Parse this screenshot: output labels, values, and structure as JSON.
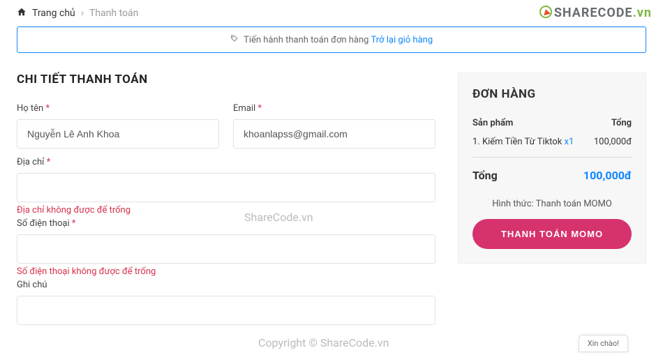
{
  "breadcrumb": {
    "home": "Trang chủ",
    "current": "Thanh toán"
  },
  "logo": {
    "brand": "SHARECODE",
    "tld": ".vn"
  },
  "alert": {
    "text": "Tiến hành thanh toán đơn hàng",
    "link": "Trở lại giỏ hàng"
  },
  "billing": {
    "title": "CHI TIẾT THANH TOÁN"
  },
  "fields": {
    "name": {
      "label": "Họ tên",
      "value": "Nguyễn Lê Anh Khoa"
    },
    "email": {
      "label": "Email",
      "value": "khoanlapss@gmail.com"
    },
    "address": {
      "label": "Địa chỉ",
      "error": "Địa chỉ không được để trống"
    },
    "phone": {
      "label": "Số điện thoại",
      "error": "Số điện thoại không được để trống"
    },
    "note": {
      "label": "Ghi chú"
    }
  },
  "order": {
    "title": "ĐƠN HÀNG",
    "head_product": "Sản phẩm",
    "head_total": "Tổng",
    "item_name": "1. Kiếm Tiền Từ Tiktok",
    "item_qty": "x1",
    "item_price": "100,000đ",
    "total_label": "Tổng",
    "total_amount": "100,000đ",
    "method": "Hình thức: Thanh toán MOMO",
    "button": "THANH TOÁN MOMO"
  },
  "watermark": {
    "a": "ShareCode.vn",
    "b": "Copyright © ShareCode.vn"
  },
  "chat": {
    "label": "Xin chào!"
  },
  "asterisk": "*"
}
